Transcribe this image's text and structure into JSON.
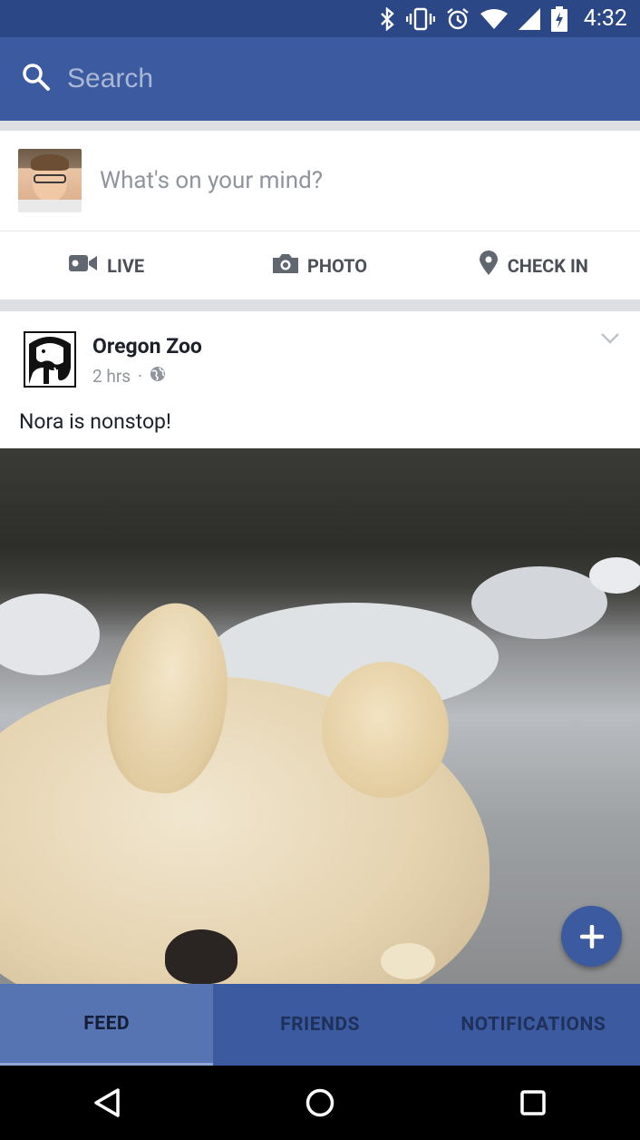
{
  "status_bar": {
    "time": "4:32",
    "icons": [
      "bluetooth-icon",
      "vibrate-icon",
      "alarm-icon",
      "wifi-icon",
      "signal-icon",
      "battery-charging-icon"
    ]
  },
  "search": {
    "placeholder": "Search"
  },
  "composer": {
    "prompt": "What's on your mind?",
    "actions": [
      {
        "label": "LIVE",
        "icon": "video-camera-icon"
      },
      {
        "label": "PHOTO",
        "icon": "camera-icon"
      },
      {
        "label": "CHECK IN",
        "icon": "location-pin-icon"
      }
    ]
  },
  "post": {
    "page_name": "Oregon Zoo",
    "time": "2 hrs",
    "audience_icon": "globe-icon",
    "text": "Nora is nonstop!"
  },
  "tabs": [
    {
      "label": "FEED",
      "active": true
    },
    {
      "label": "FRIENDS",
      "active": false
    },
    {
      "label": "NOTIFICATIONS",
      "active": false
    }
  ],
  "colors": {
    "brand": "#3b5a9f",
    "status_bar": "#2c4785",
    "active_tab": "#5673b2"
  }
}
